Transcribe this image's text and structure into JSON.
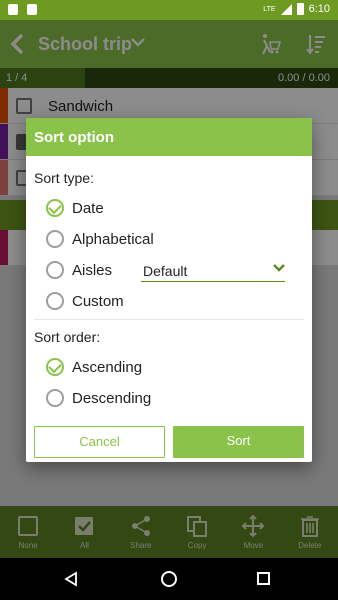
{
  "status_bar": {
    "lte": "LTE",
    "time": "6:10"
  },
  "toolbar": {
    "title": "School trip"
  },
  "progress": {
    "count": "1 / 4",
    "price": "0.00 / 0.00",
    "fraction": 0.25
  },
  "list_items": [
    {
      "label": "Sandwich",
      "color": "#e65100"
    }
  ],
  "bottom_bar": {
    "items": [
      {
        "label": "None"
      },
      {
        "label": "All"
      },
      {
        "label": "Share"
      },
      {
        "label": "Copy"
      },
      {
        "label": "Move"
      },
      {
        "label": "Delete"
      }
    ]
  },
  "dialog": {
    "title": "Sort option",
    "sort_type_label": "Sort type:",
    "sort_types": [
      {
        "label": "Date",
        "checked": true
      },
      {
        "label": "Alphabetical",
        "checked": false
      },
      {
        "label": "Aisles",
        "checked": false
      },
      {
        "label": "Custom",
        "checked": false
      }
    ],
    "aisle_select_value": "Default",
    "sort_order_label": "Sort order:",
    "sort_orders": [
      {
        "label": "Ascending",
        "checked": true
      },
      {
        "label": "Descending",
        "checked": false
      }
    ],
    "cancel_label": "Cancel",
    "sort_label": "Sort"
  },
  "colors": {
    "accent": "#8bc34a",
    "status_bar": "#6f9a22",
    "dialog_bg": "#ffffff"
  }
}
